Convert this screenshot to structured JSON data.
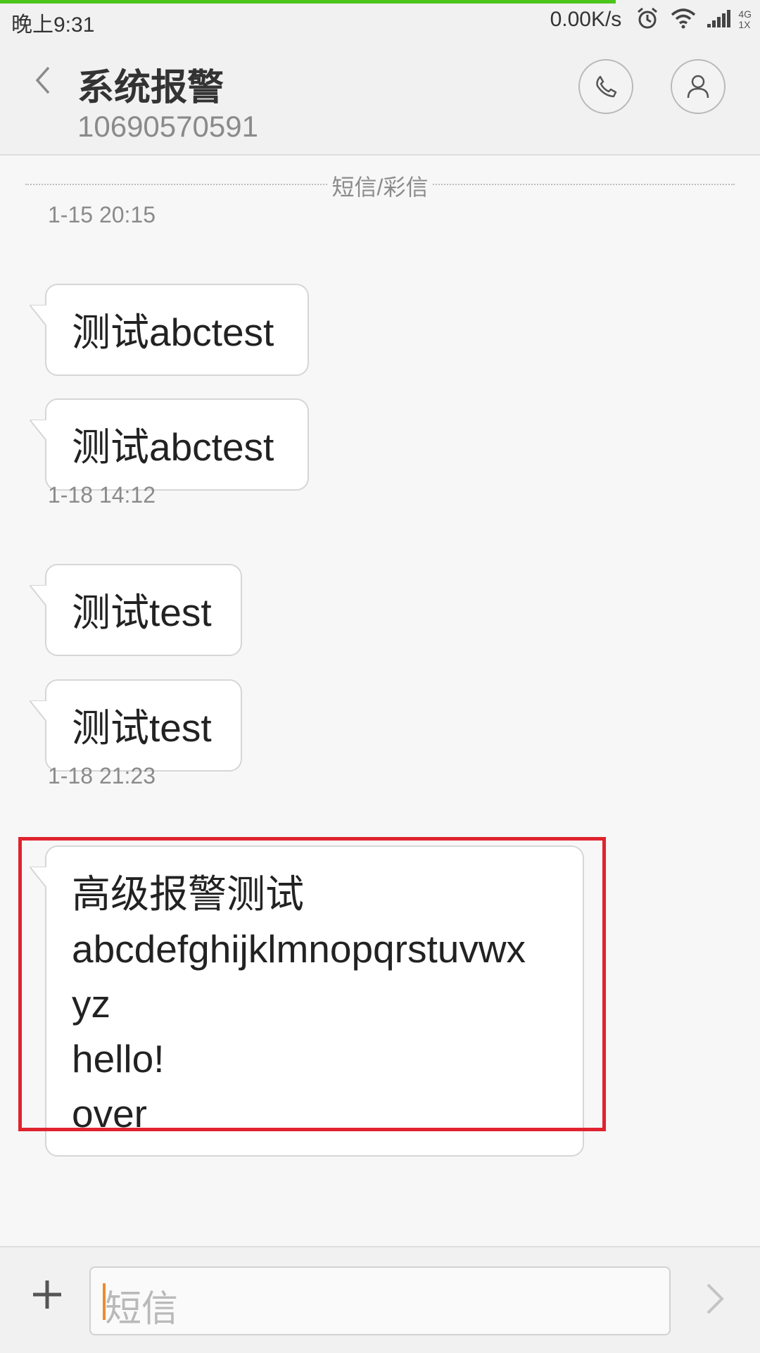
{
  "status_bar": {
    "time": "晚上9:31",
    "net_speed": "0.00K/s",
    "net_type_top": "4G",
    "net_type_bottom": "1X",
    "icons": [
      "alarm-icon",
      "wifi-icon",
      "signal-icon"
    ]
  },
  "page_load_progress": 0.81,
  "header": {
    "contact_name": "系统报警",
    "contact_number": "10690570591",
    "icons": [
      "back-arrow-icon",
      "phone-icon",
      "person-icon"
    ]
  },
  "conversation": {
    "divider_label": "短信/彩信",
    "groups": [
      {
        "timestamp": "1-15 20:15",
        "messages": [
          "测试abctest",
          "测试abctest"
        ]
      },
      {
        "timestamp": "1-18 14:12",
        "messages": [
          "测试test",
          "测试test"
        ]
      },
      {
        "timestamp": "1-18 21:23",
        "messages": [
          "高级报警测试\nabcdefghijklmnopqrstuvwx\nyz\nhello!\nover"
        ]
      }
    ]
  },
  "compose": {
    "placeholder": "短信",
    "icons": [
      "plus-icon",
      "send-arrow-icon"
    ]
  },
  "colors": {
    "progress": "#4cc51b",
    "highlight_border": "#e0232f",
    "caret": "#f08a2c"
  }
}
